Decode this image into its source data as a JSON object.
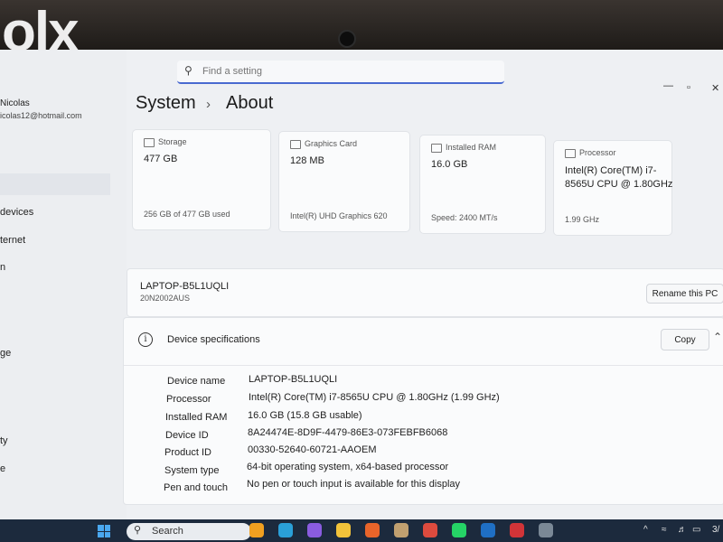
{
  "watermark": "olx",
  "window": {
    "minimize": "—",
    "maximize": "▫",
    "close": "✕"
  },
  "search": {
    "placeholder": "Find a setting",
    "icon": "search-icon"
  },
  "sidebar": {
    "user_name": "Nicolas",
    "user_email": "icolas12@hotmail.com",
    "items": [
      "devices",
      "ternet",
      "n",
      "ge",
      "ty",
      "e"
    ]
  },
  "breadcrumb": {
    "parent": "System",
    "separator": "›",
    "current": "About"
  },
  "cards": [
    {
      "label": "Storage",
      "value": "477 GB",
      "sub": "256 GB of 477 GB used",
      "icon": "storage-icon"
    },
    {
      "label": "Graphics Card",
      "value": "128 MB",
      "sub": "Intel(R) UHD Graphics 620",
      "icon": "graphics-card-icon"
    },
    {
      "label": "Installed RAM",
      "value": "16.0 GB",
      "sub": "Speed: 2400 MT/s",
      "icon": "ram-icon"
    },
    {
      "label": "Processor",
      "value": "Intel(R) Core(TM) i7-8565U CPU @ 1.80GHz",
      "sub": "1.99 GHz",
      "icon": "processor-icon"
    }
  ],
  "pc": {
    "name": "LAPTOP-B5L1UQLI",
    "model": "20N2002AUS",
    "rename_label": "Rename this PC"
  },
  "specs": {
    "title": "Device specifications",
    "copy_label": "Copy",
    "rows": [
      {
        "key": "Device name",
        "value": "LAPTOP-B5L1UQLI"
      },
      {
        "key": "Processor",
        "value": "Intel(R) Core(TM) i7-8565U CPU @ 1.80GHz (1.99 GHz)"
      },
      {
        "key": "Installed RAM",
        "value": "16.0 GB (15.8 GB usable)"
      },
      {
        "key": "Device ID",
        "value": "8A24474E-8D9F-4479-86E3-073FEBFB6068"
      },
      {
        "key": "Product ID",
        "value": "00330-52640-60721-AAOEM"
      },
      {
        "key": "System type",
        "value": "64-bit operating system, x64-based processor"
      },
      {
        "key": "Pen and touch",
        "value": "No pen or touch input is available for this display"
      }
    ]
  },
  "taskbar": {
    "search_label": "Search",
    "apps": [
      {
        "name": "widgets-icon",
        "color": "#f0a020"
      },
      {
        "name": "edge-icon",
        "color": "#2aa0d8"
      },
      {
        "name": "copilot-icon",
        "color": "#8a5ce0"
      },
      {
        "name": "file-explorer-icon",
        "color": "#f2c33a"
      },
      {
        "name": "firefox-icon",
        "color": "#e8642a"
      },
      {
        "name": "photos-icon",
        "color": "#c0a070"
      },
      {
        "name": "chrome-icon",
        "color": "#dd4b3e"
      },
      {
        "name": "whatsapp-icon",
        "color": "#25d366"
      },
      {
        "name": "outlook-icon",
        "color": "#1f6fc4"
      },
      {
        "name": "office-lens-icon",
        "color": "#d13438"
      },
      {
        "name": "settings-icon",
        "color": "#7a8896"
      }
    ],
    "tray_time": "3/"
  }
}
